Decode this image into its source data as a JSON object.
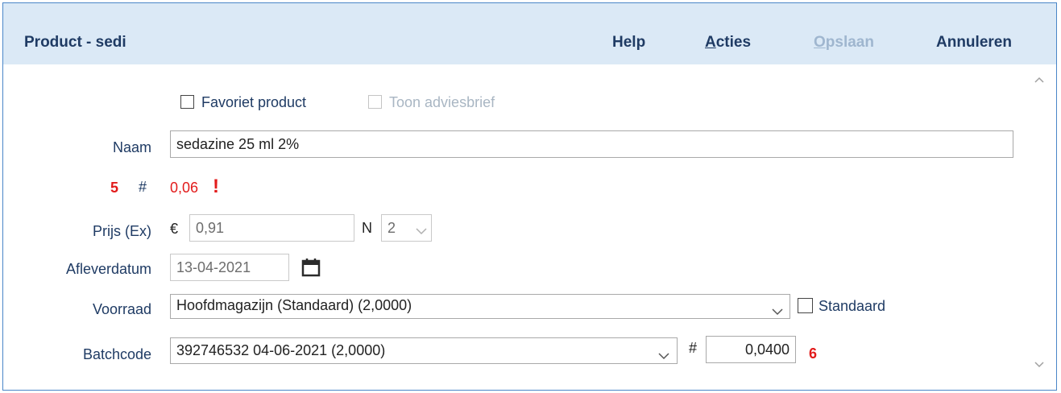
{
  "header": {
    "title": "Product - sedi",
    "help": "Help",
    "acties_first": "A",
    "acties_rest": "cties",
    "opslaan_first": "O",
    "opslaan_rest": "pslaan",
    "annuleren": "Annuleren"
  },
  "form": {
    "favoriet_label": "Favoriet product",
    "favoriet_checked": false,
    "toon_label": "Toon adviesbrief",
    "toon_checked": false,
    "naam_label": "Naam",
    "naam_value": "sedazine 25 ml 2%",
    "count_number": "5",
    "hash1": "#",
    "amount_value": "0,06",
    "warning_mark": "!",
    "prijs_label": "Prijs (Ex)",
    "currency": "€",
    "prijs_value": "0,91",
    "n_label": "N",
    "n_value": "2",
    "afleverdatum_label": "Afleverdatum",
    "afleverdatum_value": "13-04-2021",
    "voorraad_label": "Voorraad",
    "voorraad_value": "Hoofdmagazijn (Standaard) (2,0000)",
    "standaard_label": "Standaard",
    "standaard_checked": false,
    "batchcode_label": "Batchcode",
    "batchcode_value": "392746532 04-06-2021 (2,0000)",
    "hash2": "#",
    "batch_qty": "0,0400",
    "batch_number": "6"
  },
  "icons": {
    "calendar": "calendar-icon",
    "chevron": "chevron-down-icon",
    "scroll_up": "scroll-up-icon",
    "scroll_down": "scroll-down-icon"
  },
  "colors": {
    "header_bg": "#dbe9f6",
    "border": "#4a86c8",
    "text": "#1f3b64",
    "accent_red": "#e21b1b"
  }
}
